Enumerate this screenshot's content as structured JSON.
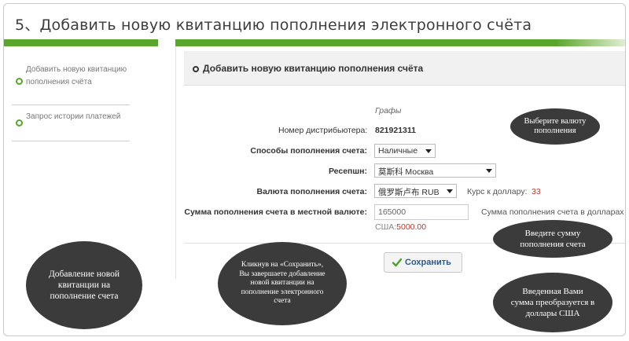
{
  "slide": {
    "title": "5、Добавить новую квитанцию пополнения электронного счёта"
  },
  "colors": {
    "accent_green": "#5aa62c",
    "bubble_bg": "#3b3b3b",
    "amount_red": "#c0392b"
  },
  "sidebar": {
    "items": [
      {
        "label": "Добавить новую квитанцию пополнения счёта",
        "icon": "radio-circle-icon"
      },
      {
        "label": "Запрос истории платежей",
        "icon": "radio-circle-icon"
      }
    ]
  },
  "panel": {
    "header": "Добавить новую квитанцию пополнения счёта",
    "graph_label": "Графы",
    "distributor_label": "Номер дистрибьютера:",
    "distributor_value": "821921311",
    "method_label": "Способы пополнения счета:",
    "method_value": "Наличные",
    "reception_label": "Ресепшн:",
    "reception_value": "莫斯科 Москва",
    "currency_label": "Валюта пополнения счета:",
    "currency_value": "俄罗斯卢布 RUB",
    "rate_label": "Курс к доллару:",
    "rate_value": "33",
    "amount_label": "Сумма пополнения счета в местной валюте:",
    "amount_value": "165000",
    "usd_label": "Сумма пополнения счета в долларах",
    "usd_prefix": "США:",
    "usd_value": "5000.00",
    "save_label": "Сохранить"
  },
  "callouts": {
    "currency": "Выберите валюту пополнения",
    "amount": "Введите сумму пополнения счета",
    "converted": "Введенная Вами сумма преобразуется в доллары США",
    "add": "Добавление новой квитанции на пополнение счета",
    "save": "Кликнув на «Сохранить», Вы завершаете добавление новой квитанции на пополнение электронного счета"
  }
}
